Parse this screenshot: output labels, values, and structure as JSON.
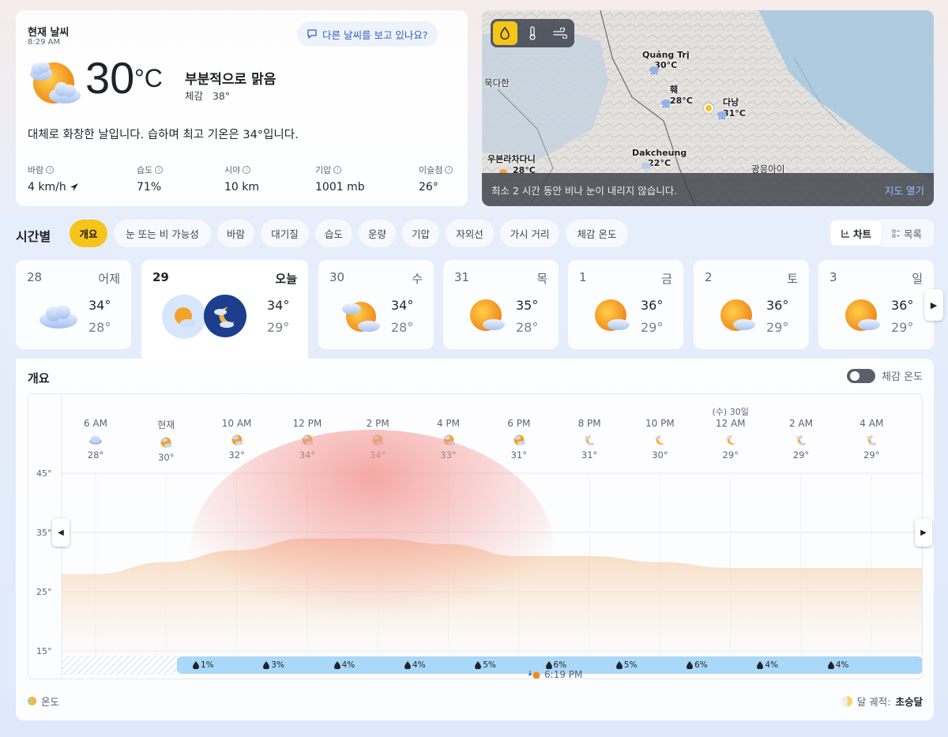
{
  "current": {
    "title": "현재 날씨",
    "time": "8:29 AM",
    "feedback": "다른 날씨를 보고 있나요?",
    "temp": "30",
    "unit": "°C",
    "condition": "부분적으로 맑음",
    "feels_label": "체감",
    "feels_value": "38°",
    "description": "대체로 화창한 날입니다. 습하며 최고 기온은 34°입니다.",
    "metrics": [
      {
        "label": "바람",
        "value": "4 km/h"
      },
      {
        "label": "습도",
        "value": "71%"
      },
      {
        "label": "시야",
        "value": "10 km"
      },
      {
        "label": "기압",
        "value": "1001 mb"
      },
      {
        "label": "이슬점",
        "value": "26°"
      }
    ]
  },
  "map": {
    "places": [
      {
        "name": "Quảng Trị",
        "temp": "30°C"
      },
      {
        "name": "훼",
        "temp": "28°C"
      },
      {
        "name": "다낭",
        "temp": "31°C"
      },
      {
        "name": "Dakcheung",
        "temp": "22°C"
      },
      {
        "name": "우본라차다니",
        "temp": "28°C"
      }
    ],
    "labels": [
      "묵다한",
      "광응아이"
    ],
    "message": "최소 2 시간 동안 비나 눈이 내리지 않습니다.",
    "open_label": "지도 열기",
    "active_layer_color": "#f5c518"
  },
  "hourly": {
    "title": "시간별",
    "tabs": [
      "개요",
      "눈 또는 비 가능성",
      "바람",
      "대기질",
      "습도",
      "운량",
      "기압",
      "자외선",
      "가시 거리",
      "체감 온도"
    ],
    "view_chart": "차트",
    "view_list": "목록"
  },
  "days": [
    {
      "num": "28",
      "name": "어제",
      "hi": "34°",
      "lo": "28°",
      "icon": "cloud-icon"
    },
    {
      "num": "29",
      "name": "오늘",
      "hi": "34°",
      "lo": "29°",
      "icon": "partly-sunny-icon"
    },
    {
      "num": "30",
      "name": "수",
      "hi": "34°",
      "lo": "28°",
      "icon": "partly-sunny-icon"
    },
    {
      "num": "31",
      "name": "목",
      "hi": "35°",
      "lo": "28°",
      "icon": "partly-sunny-icon"
    },
    {
      "num": "1",
      "name": "금",
      "hi": "36°",
      "lo": "29°",
      "icon": "partly-sunny-icon"
    },
    {
      "num": "2",
      "name": "토",
      "hi": "36°",
      "lo": "29°",
      "icon": "partly-sunny-icon"
    },
    {
      "num": "3",
      "name": "일",
      "hi": "36°",
      "lo": "29°",
      "icon": "partly-sunny-icon"
    }
  ],
  "overview": {
    "title": "개요",
    "feels_toggle": "체감 온도",
    "sunset": "6:19 PM",
    "legend_temp": "온도",
    "legend_moon_label": "달 궤적:",
    "legend_moon_value": "초승달",
    "date_marker": "(수) 30일"
  },
  "chart_data": {
    "type": "area",
    "ylim": [
      15,
      45
    ],
    "yticks": [
      "45°",
      "35°",
      "25°",
      "15°"
    ],
    "hours": [
      "6 AM",
      "현재",
      "10 AM",
      "12 PM",
      "2 PM",
      "4 PM",
      "6 PM",
      "8 PM",
      "10 PM",
      "12 AM",
      "2 AM",
      "4 AM"
    ],
    "temps": [
      28,
      30,
      32,
      34,
      34,
      33,
      31,
      31,
      30,
      29,
      29,
      29
    ],
    "temp_labels": [
      "28°",
      "30°",
      "32°",
      "34°",
      "34°",
      "33°",
      "31°",
      "31°",
      "30°",
      "29°",
      "29°",
      "29°"
    ],
    "icons": [
      "cloud-icon",
      "partly-sunny-icon",
      "partly-sunny-icon",
      "partly-sunny-icon",
      "partly-sunny-icon",
      "partly-sunny-icon",
      "partly-sunny-icon",
      "partly-cloudy-night-icon",
      "moon-icon",
      "moon-icon",
      "partly-cloudy-night-icon",
      "partly-cloudy-night-icon"
    ],
    "precip": [
      "1%",
      "3%",
      "4%",
      "4%",
      "5%",
      "6%",
      "5%",
      "6%",
      "4%",
      "4%"
    ]
  }
}
